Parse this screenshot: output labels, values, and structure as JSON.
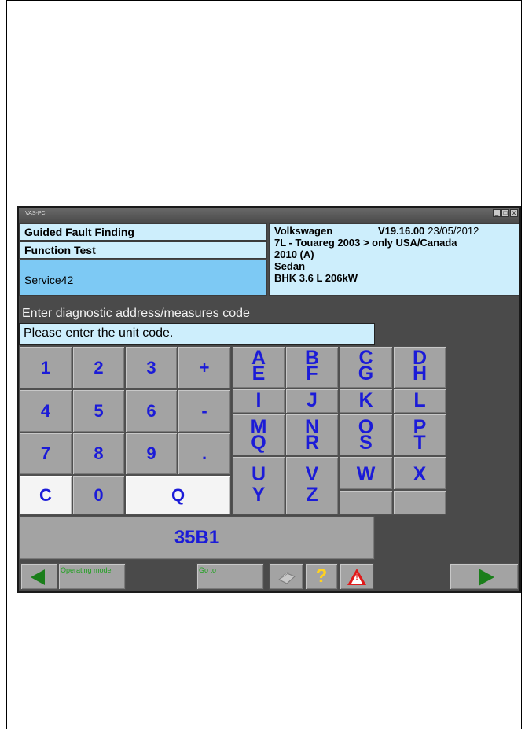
{
  "window": {
    "title": "VAS-PC",
    "controls": [
      "_",
      "□",
      "x"
    ]
  },
  "info": {
    "guided_fault_finding": "Guided Fault Finding",
    "function_test": "Function Test",
    "service": "Service42",
    "brand": "Volkswagen",
    "version": "V19.16.00",
    "date": "23/05/2012",
    "model_line1": "7L - Touareg 2003 > only USA/Canada",
    "model_line2": "2010 (A)",
    "body": "Sedan",
    "engine": "BHK 3.6 L 206kW"
  },
  "prompt": {
    "title": "Enter diagnostic address/measures code",
    "message": "Please enter the unit code."
  },
  "keypad": {
    "k1": "1",
    "k2": "2",
    "k3": "3",
    "plus": "+",
    "k4": "4",
    "k5": "5",
    "k6": "6",
    "minus": "-",
    "k7": "7",
    "k8": "8",
    "k9": "9",
    "dot": ".",
    "clear": "C",
    "k0": "0",
    "quit": "Q"
  },
  "alpha_keys": [
    [
      "A",
      "E"
    ],
    [
      "B",
      "F"
    ],
    [
      "C",
      "G"
    ],
    [
      "D",
      "H"
    ],
    [
      "I",
      ""
    ],
    [
      "J",
      ""
    ],
    [
      "K",
      ""
    ],
    [
      "L",
      ""
    ],
    [
      "M",
      "Q"
    ],
    [
      "N",
      "R"
    ],
    [
      "O",
      "S"
    ],
    [
      "P",
      "T"
    ],
    [
      "U",
      "Y"
    ],
    [
      "V",
      "Z"
    ],
    [
      "W",
      ""
    ],
    [
      "X",
      ""
    ]
  ],
  "result": {
    "value": "35B1"
  },
  "toolbar": {
    "operating_mode_label": "Operating mode",
    "goto_label": "Go to",
    "help_label": "?",
    "back_icon": "back-arrow-icon",
    "next_icon": "next-arrow-icon",
    "print_icon": "printer-icon",
    "warning_icon": "warning-icon"
  },
  "colors": {
    "info_bg": "#cdeefc",
    "selected_bg": "#7dc9f4",
    "key_bg": "#a3a3a3",
    "key_text": "#1b1bd8",
    "arrow": "#1a7e1a",
    "help": "#ffd21f",
    "warning": "#e01a1a"
  }
}
